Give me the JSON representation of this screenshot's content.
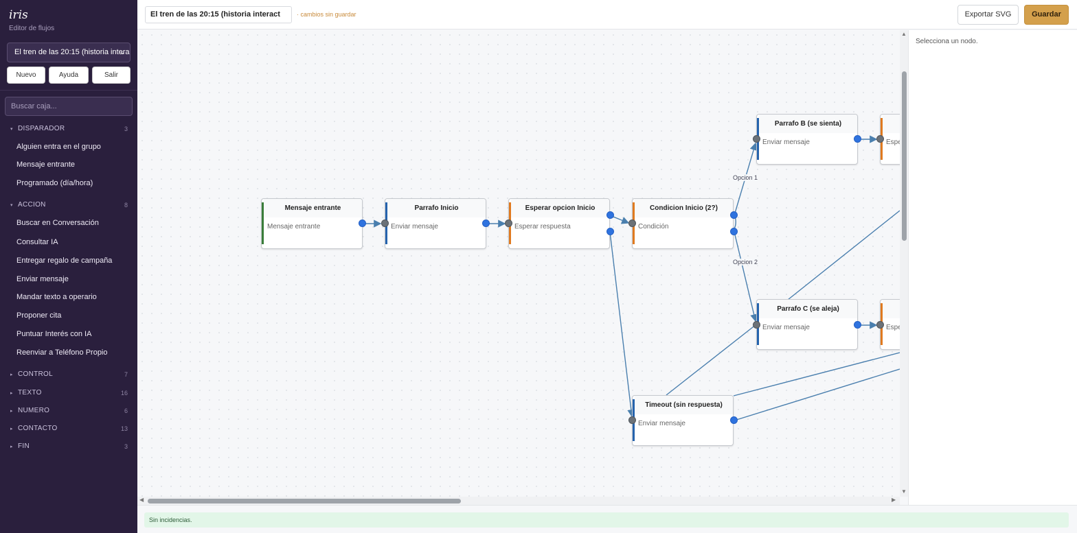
{
  "brand": {
    "name": "iris",
    "subtitle": "Editor de flujos"
  },
  "sidebar": {
    "flow_select_value": "El tren de las 20:15 (historia interact",
    "buttons": {
      "new": "Nuevo",
      "help": "Ayuda",
      "exit": "Salir"
    },
    "search_placeholder": "Buscar caja...",
    "categories": [
      {
        "name": "DISPARADOR",
        "count": "3",
        "expanded": true,
        "items": [
          "Alguien entra en el grupo",
          "Mensaje entrante",
          "Programado (día/hora)"
        ]
      },
      {
        "name": "ACCION",
        "count": "8",
        "expanded": true,
        "items": [
          "Buscar en Conversación",
          "Consultar IA",
          "Entregar regalo de campaña",
          "Enviar mensaje",
          "Mandar texto a operario",
          "Proponer cita",
          "Puntuar Interés con IA",
          "Reenviar a Teléfono Propio"
        ]
      },
      {
        "name": "CONTROL",
        "count": "7",
        "expanded": false
      },
      {
        "name": "TEXTO",
        "count": "16",
        "expanded": false
      },
      {
        "name": "NUMERO",
        "count": "6",
        "expanded": false
      },
      {
        "name": "CONTACTO",
        "count": "13",
        "expanded": false
      },
      {
        "name": "FIN",
        "count": "3",
        "expanded": false
      }
    ]
  },
  "header": {
    "flow_title": "El tren de las 20:15 (historia interact",
    "unsaved_notice": "· cambios sin guardar",
    "export_label": "Exportar SVG",
    "save_label": "Guardar"
  },
  "canvas": {
    "nodes": [
      {
        "id": "n1",
        "title": "Mensaje entrante",
        "subtitle": "Mensaje entrante"
      },
      {
        "id": "n2",
        "title": "Parrafo Inicio",
        "subtitle": "Enviar mensaje"
      },
      {
        "id": "n3",
        "title": "Esperar opcion Inicio",
        "subtitle": "Esperar respuesta"
      },
      {
        "id": "n4",
        "title": "Condicion Inicio (2?)",
        "subtitle": "Condición"
      },
      {
        "id": "n5",
        "title": "Parrafo B (se sienta)",
        "subtitle": "Enviar mensaje"
      },
      {
        "id": "n6",
        "title": "Parrafo C (se aleja)",
        "subtitle": "Enviar mensaje"
      },
      {
        "id": "n7",
        "title": "Timeout (sin respuesta)",
        "subtitle": "Enviar mensaje"
      },
      {
        "id": "n8",
        "title": "",
        "subtitle": "Espe"
      },
      {
        "id": "n9",
        "title": "",
        "subtitle": "Espe"
      }
    ],
    "edge_labels": {
      "option1": "Opcion 1",
      "option2": "Opcion 2"
    },
    "colors": {
      "trigger": "#3a7d3a",
      "action": "#2563ad",
      "control": "#e07a1f",
      "edge": "#4a7fae",
      "port_out": "#2f73df",
      "port_in": "#6c7278"
    }
  },
  "inspector": {
    "hint": "Selecciona un nodo."
  },
  "status": {
    "message": "Sin incidencias."
  },
  "icons": {
    "select_chevron": "chevron-down-icon",
    "expanded": "triangle-down-icon",
    "collapsed": "triangle-right-icon"
  }
}
